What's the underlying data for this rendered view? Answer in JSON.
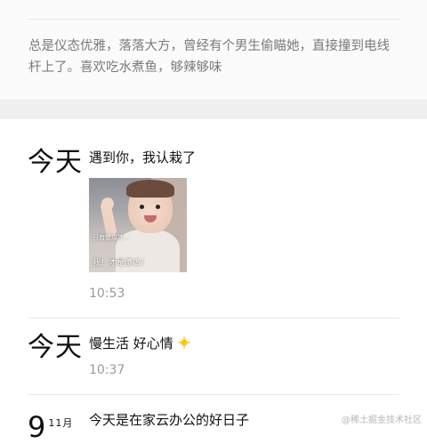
{
  "profile": {
    "bio": "总是仪态优雅，落落大方，曾经有个男生偷瞄她，直接撞到电线杆上了。喜欢吃水煮鱼，够辣够味"
  },
  "posts": [
    {
      "date_label": "今天",
      "text": "遇到你，我认栽了",
      "time": "10:53",
      "photo": {
        "caption_top": "只有傻瓜才...",
        "caption_bottom": "我！才是傻瓜！"
      }
    },
    {
      "date_label": "今天",
      "text": "慢生活 好心情",
      "time": "10:37",
      "emoji": "sparkle-icon"
    },
    {
      "date_label": "9",
      "date_suffix": "11月",
      "text": "今天是在家云办公的好日子"
    }
  ],
  "watermark": "@稀土掘金技术社区",
  "colors": {
    "bio_text": "#7a7a7a",
    "time_text": "#9a9a9a",
    "section_gap": "#efefef",
    "sparkle": "#f5c518"
  }
}
